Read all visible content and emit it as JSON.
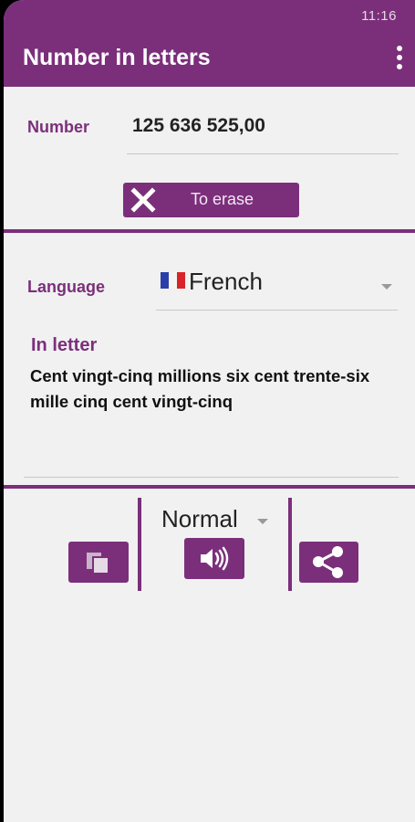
{
  "status_bar": {
    "time": "11:16"
  },
  "app_bar": {
    "title": "Number in letters",
    "menu_icon": "more-vert-icon"
  },
  "number_section": {
    "label": "Number",
    "value": "125 636 525,00"
  },
  "erase_button": {
    "label": "To erase",
    "icon": "close-icon"
  },
  "language_section": {
    "label": "Language",
    "selected": "French",
    "flag_icon": "french-flag-icon"
  },
  "result_section": {
    "label": "In letter",
    "text": "Cent vingt-cinq millions six cent trente-six mille cinq cent vingt-cinq"
  },
  "actions": {
    "copy_icon": "copy-icon",
    "speed_selected": "Normal",
    "speak_icon": "volume-icon",
    "share_icon": "share-icon"
  },
  "colors": {
    "accent": "#7b2f7b",
    "background": "#f1f1f1"
  }
}
